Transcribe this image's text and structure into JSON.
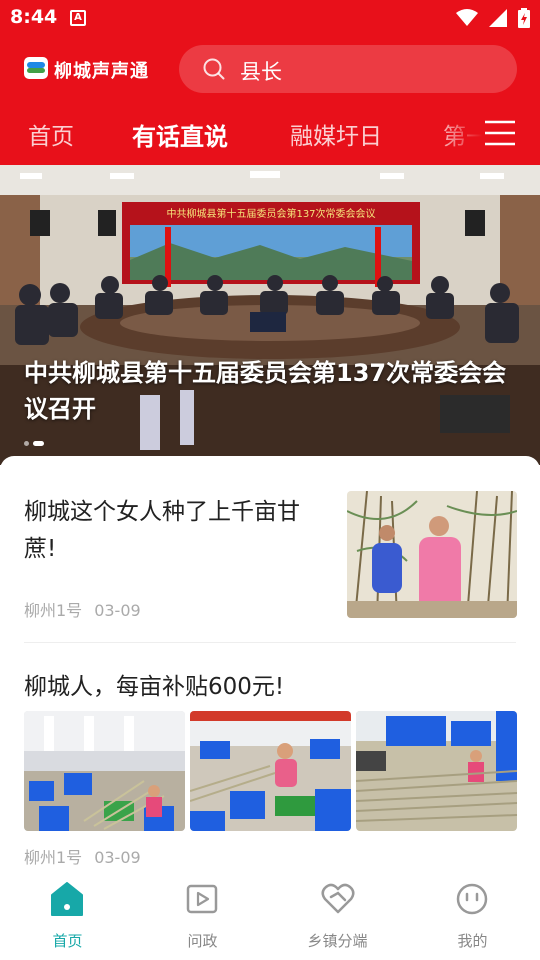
{
  "status_bar": {
    "time": "8:44",
    "notification_letter": "A"
  },
  "header": {
    "app_name": "柳城声声通",
    "search_text": "县长"
  },
  "tabs": [
    {
      "label": "首页",
      "active": false
    },
    {
      "label": "有话直说",
      "active": true
    },
    {
      "label": "融媒圩日",
      "active": false
    },
    {
      "label": "第一",
      "active": false
    }
  ],
  "banner": {
    "title": "中共柳城县第十五届委员会第137次常委会会议召开",
    "screen_caption": "中共柳城县第十五届委员会第137次常委会会议",
    "slides_count": 2,
    "active_slide": 2
  },
  "news": [
    {
      "title": "柳城这个女人种了上千亩甘蔗!",
      "source": "柳州1号",
      "date": "03-09"
    },
    {
      "title": "柳城人，每亩补贴600元!",
      "source": "柳州1号",
      "date": "03-09"
    }
  ],
  "bottom_nav": [
    {
      "label": "首页",
      "icon": "home-icon",
      "active": true
    },
    {
      "label": "问政",
      "icon": "play-icon",
      "active": false
    },
    {
      "label": "乡镇分端",
      "icon": "heart-handshake-icon",
      "active": false
    },
    {
      "label": "我的",
      "icon": "smiley-icon",
      "active": false
    }
  ],
  "colors": {
    "brand_red": "#e8101a",
    "active_teal": "#17a8a8"
  }
}
